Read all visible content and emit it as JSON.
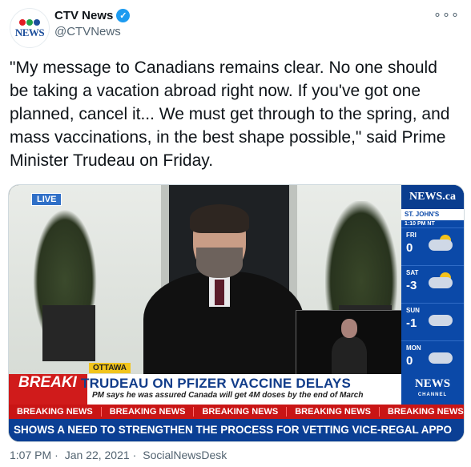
{
  "account": {
    "name": "CTV News",
    "handle": "@CTVNews",
    "avatar_text": "NEWS",
    "verified": true
  },
  "more_icon": "more-dots-icon",
  "tweet_text": "\"My message to Canadians remains clear. No one should be taking a vacation abroad right now. If you've got one planned, cancel it... We must get through to the spring, and mass vaccinations, in the best shape possible,\" said Prime Minister Trudeau on Friday.",
  "media": {
    "live_badge": "LIVE",
    "brand": "NEWS.ca",
    "weather": {
      "city": "ST. JOHN'S",
      "time": "1:10 PM NT",
      "days": [
        {
          "name": "FRI",
          "temp": "0"
        },
        {
          "name": "SAT",
          "temp": "-3"
        },
        {
          "name": "SUN",
          "temp": "-1"
        },
        {
          "name": "MON",
          "temp": "0"
        }
      ]
    },
    "location_tag": "OTTAWA",
    "breaking_badge": "BREAKI",
    "headline": "TRUDEAU ON PFIZER VACCINE DELAYS",
    "subhead": "PM says he was assured Canada will get 4M doses by the end of March",
    "lower_logo": "NEWS",
    "lower_logo_sub": "CHANNEL",
    "crawl_item": "BREAKING NEWS",
    "ticker": "SHOWS A NEED TO STRENGTHEN THE PROCESS FOR VETTING VICE-REGAL APPO"
  },
  "meta": {
    "time": "1:07 PM",
    "date": "Jan 22, 2021",
    "source": "SocialNewsDesk"
  },
  "colors": {
    "verified": "#1d9bf0",
    "ctv_blue": "#0b49a8",
    "breaking_red": "#c91515",
    "text_gray": "#536471"
  }
}
